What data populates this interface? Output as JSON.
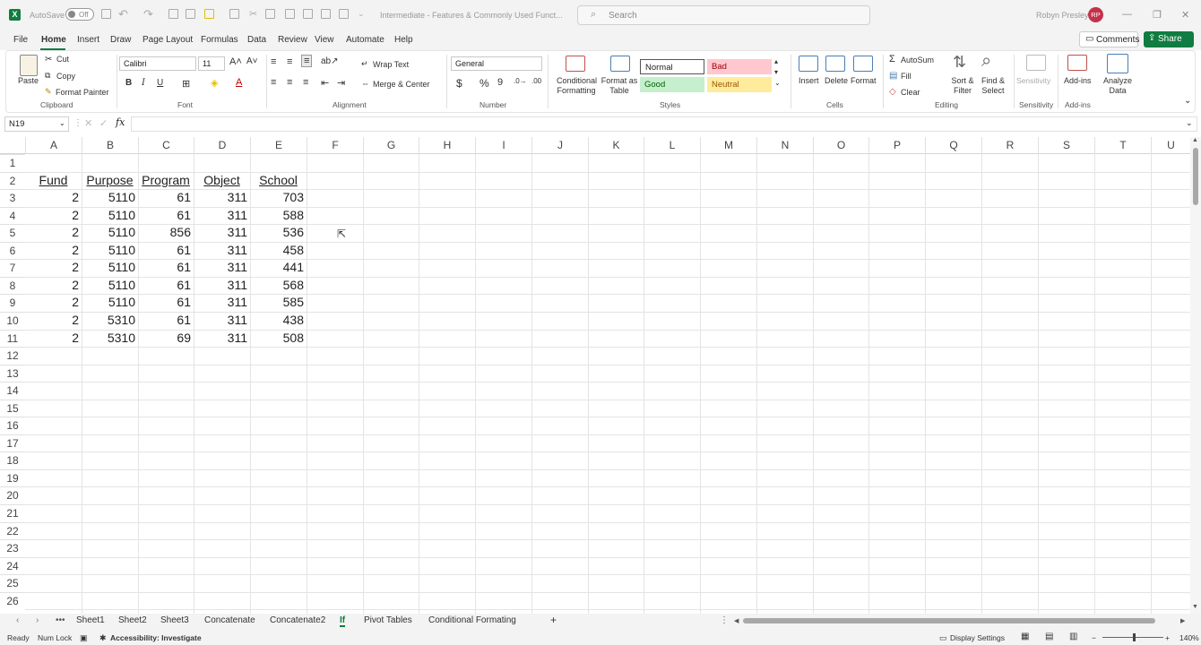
{
  "title_bar": {
    "autosave_label": "AutoSave",
    "autosave_state": "Off",
    "document_title": "Intermediate - Features & Commonly Used Funct...",
    "search_placeholder": "Search",
    "user_name": "Robyn Presley",
    "user_initials": "RP",
    "brand_color": "#107c41",
    "avatar_color": "#c4314b"
  },
  "menu": {
    "items": [
      "File",
      "Home",
      "Insert",
      "Draw",
      "Page Layout",
      "Formulas",
      "Data",
      "Review",
      "View",
      "Automate",
      "Help"
    ],
    "active": "Home",
    "comments_label": "Comments",
    "share_label": "Share"
  },
  "ribbon": {
    "clipboard": {
      "paste": "Paste",
      "cut": "Cut",
      "copy": "Copy",
      "format_painter": "Format Painter",
      "group": "Clipboard"
    },
    "font": {
      "family": "Calibri",
      "size": "11",
      "bold": "B",
      "italic": "I",
      "underline": "U",
      "group": "Font"
    },
    "alignment": {
      "wrap_text": "Wrap Text",
      "merge_center": "Merge & Center",
      "group": "Alignment"
    },
    "number": {
      "format": "General",
      "group": "Number"
    },
    "styles": {
      "conditional_formatting": "Conditional Formatting",
      "format_as_table": "Format as Table",
      "normal": "Normal",
      "bad": "Bad",
      "good": "Good",
      "neutral": "Neutral",
      "group": "Styles"
    },
    "cells": {
      "insert": "Insert",
      "delete": "Delete",
      "format": "Format",
      "group": "Cells"
    },
    "editing": {
      "autosum": "AutoSum",
      "fill": "Fill",
      "clear": "Clear",
      "sort_filter": "Sort & Filter",
      "find_select": "Find & Select",
      "group": "Editing"
    },
    "sensitivity": {
      "label": "Sensitivity",
      "group": "Sensitivity"
    },
    "addins": {
      "label": "Add-ins",
      "group": "Add-ins",
      "analyze_data": "Analyze Data"
    }
  },
  "formula_bar": {
    "name_box": "N19",
    "fx": "fx",
    "formula": ""
  },
  "sheet": {
    "columns": [
      "A",
      "B",
      "C",
      "D",
      "E",
      "F",
      "G",
      "H",
      "I",
      "J",
      "K",
      "L",
      "M",
      "N",
      "O",
      "P",
      "Q",
      "R",
      "S",
      "T",
      "U"
    ],
    "rows": [
      "1",
      "2",
      "3",
      "4",
      "5",
      "6",
      "7",
      "8",
      "9",
      "10",
      "11",
      "12",
      "13",
      "14",
      "15",
      "16",
      "17",
      "18",
      "19",
      "20",
      "21",
      "22",
      "23",
      "24",
      "25",
      "26"
    ],
    "headers": [
      "Fund",
      "Purpose",
      "Program",
      "Object",
      "School"
    ],
    "data": [
      [
        "2",
        "5110",
        "61",
        "311",
        "703"
      ],
      [
        "2",
        "5110",
        "61",
        "311",
        "588"
      ],
      [
        "2",
        "5110",
        "856",
        "311",
        "536"
      ],
      [
        "2",
        "5110",
        "61",
        "311",
        "458"
      ],
      [
        "2",
        "5110",
        "61",
        "311",
        "441"
      ],
      [
        "2",
        "5110",
        "61",
        "311",
        "568"
      ],
      [
        "2",
        "5110",
        "61",
        "311",
        "585"
      ],
      [
        "2",
        "5310",
        "61",
        "311",
        "438"
      ],
      [
        "2",
        "5310",
        "69",
        "311",
        "508"
      ]
    ]
  },
  "tabs": {
    "items": [
      "Sheet1",
      "Sheet2",
      "Sheet3",
      "Concatenate",
      "Concatenate2",
      "If",
      "Pivot Tables",
      "Conditional Formating"
    ],
    "active": "If"
  },
  "status": {
    "ready": "Ready",
    "num_lock": "Num Lock",
    "accessibility": "Accessibility: Investigate",
    "display_settings": "Display Settings",
    "zoom": "140%"
  }
}
